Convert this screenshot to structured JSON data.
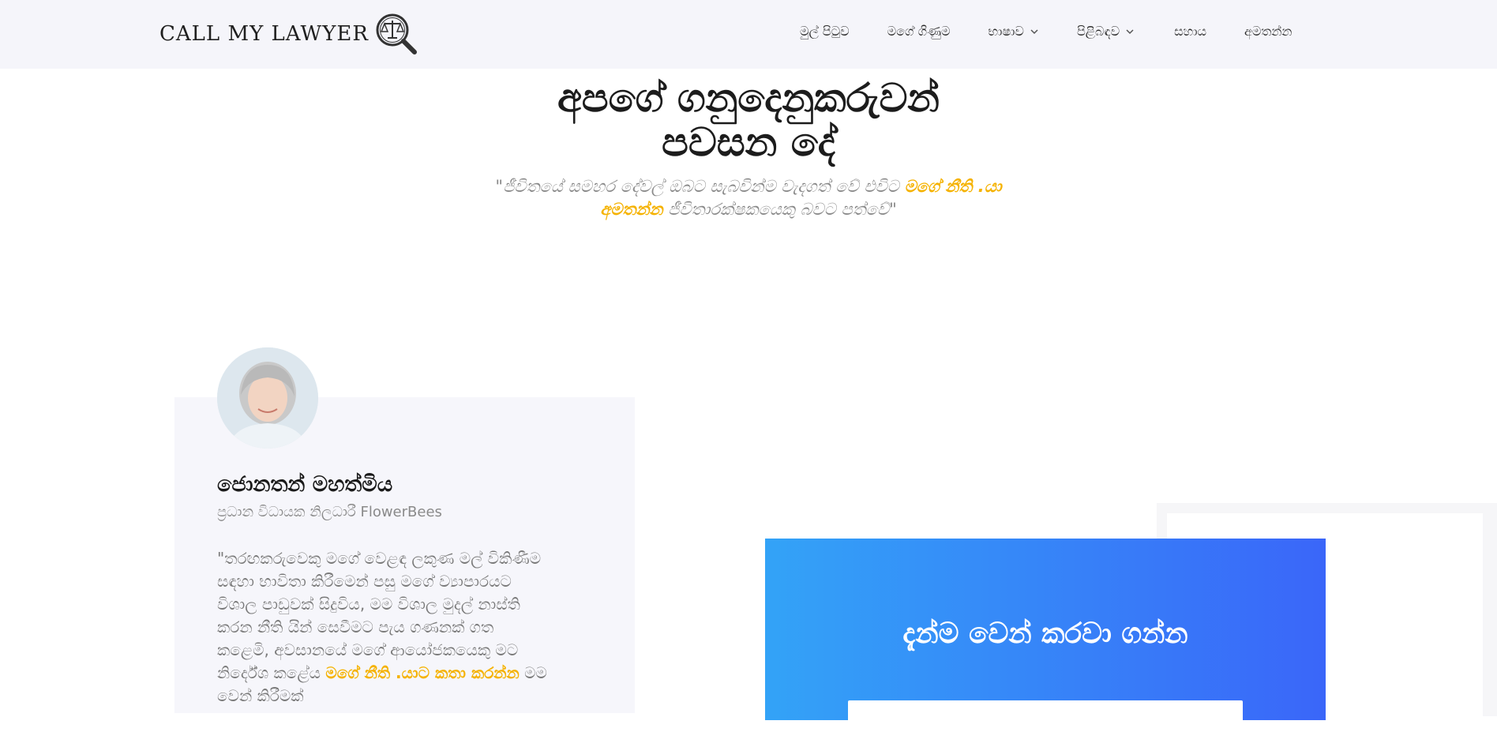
{
  "header": {
    "logo_text": "CALL MY LAWYER",
    "nav": [
      {
        "label": "මුල් පිටුව",
        "has_dropdown": false
      },
      {
        "label": "මගේ ගිණුම",
        "has_dropdown": false
      },
      {
        "label": "භාෂාව",
        "has_dropdown": true
      },
      {
        "label": "පිළිබඳව",
        "has_dropdown": true
      },
      {
        "label": "සහාය",
        "has_dropdown": false
      },
      {
        "label": "අමතන්න",
        "has_dropdown": false
      }
    ]
  },
  "section": {
    "heading_line1": "අපගේ ගනුදෙනුකරුවන්",
    "heading_line2": "පවසන දේ",
    "sub_part1": "\"ජීවිතයේ සමහර දේවල් ඔබට සැබවින්ම වැදගත් වේ එවිට ",
    "sub_highlight": "මගේ නීති .යා අමතන්න",
    "sub_part2": " ජීවිතාරක්ෂකයෙකු බවට පත්වේ\""
  },
  "testimonial": {
    "name": "ජොනතන් මහත්මිය",
    "role": "ප්‍රධාන විධායක නිලධාරී FlowerBees",
    "quote_part1": "\"තරඟකරුවෙකු මගේ වෙළඳ ලකුණ මල් විකිණීම සඳහා භාවිතා කිරීමෙන් පසු මගේ ව්‍යාපාරයට විශාල පාඩුවක් සිදුවිය, මම විශාල මුදල් නාස්ති කරන නීති යින් සෙවීමට පැය ගණනක් ගත කළෙමි, අවසානයේ මගේ ආයෝජකයෙකු මට නිර්දේශ කළේය ",
    "quote_highlight": "මගේ නීති .යාට කතා කරන්න",
    "quote_part2": " මම වෙන් කිරීමක්"
  },
  "cta": {
    "title": "දැන්ම වෙන් කරවා ගන්න"
  },
  "colors": {
    "accent": "#f5b200",
    "header_bg": "#f5f5fa",
    "cta_gradient_start": "#33a3f7",
    "cta_gradient_end": "#3a66f9"
  },
  "icons": {
    "logo": "scales-magnifier-icon",
    "dropdown": "chevron-down-icon"
  }
}
